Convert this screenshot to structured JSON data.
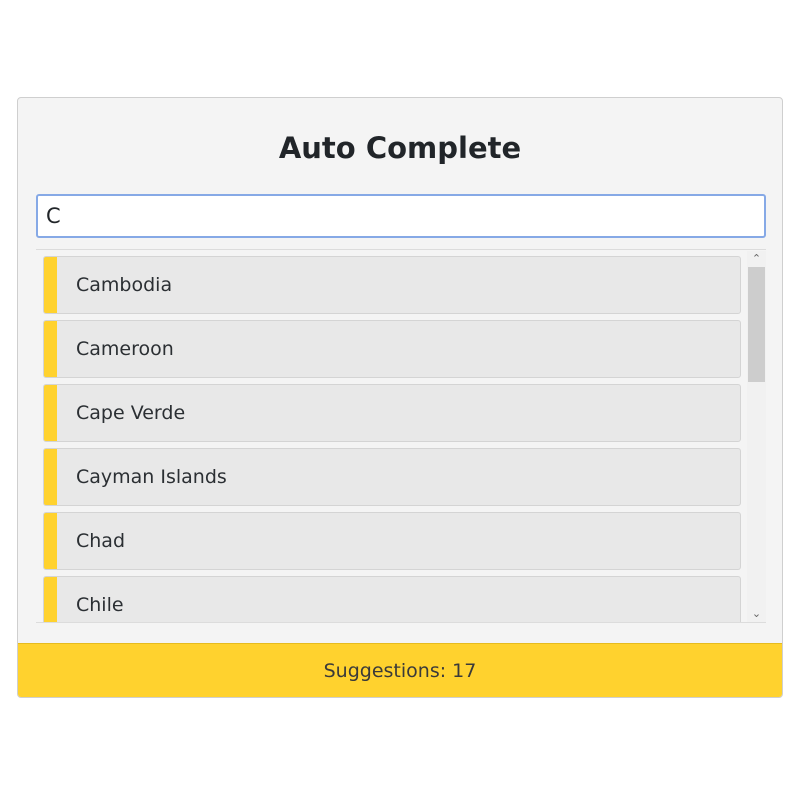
{
  "widget": {
    "title": "Auto Complete",
    "search_value": "C",
    "suggestions_label": "Suggestions: 17"
  },
  "suggestions": [
    {
      "label": "Cambodia"
    },
    {
      "label": "Cameroon"
    },
    {
      "label": "Cape Verde"
    },
    {
      "label": "Cayman Islands"
    },
    {
      "label": "Chad"
    },
    {
      "label": "Chile"
    }
  ],
  "icons": {
    "scroll_up": "chevron-up-icon",
    "scroll_down": "chevron-down-icon"
  },
  "colors": {
    "accent": "#ffd22e",
    "focus_border": "#86a9e6"
  }
}
